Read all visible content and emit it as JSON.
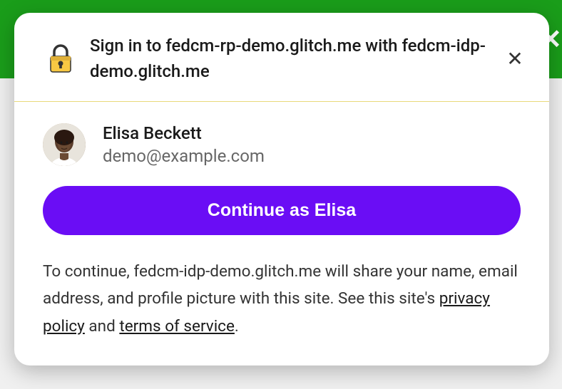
{
  "dialog": {
    "title": "Sign in to fedcm-rp-demo.glitch.me with fedcm-idp-demo.glitch.me"
  },
  "account": {
    "name": "Elisa Beckett",
    "email": "demo@example.com"
  },
  "continueButton": {
    "label": "Continue as Elisa"
  },
  "disclosure": {
    "prefix": "To continue, fedcm-idp-demo.glitch.me will share your name, email address, and profile picture with this site. See this site's ",
    "privacyPolicy": "privacy policy",
    "and": " and ",
    "terms": "terms of service",
    "suffix": "."
  }
}
